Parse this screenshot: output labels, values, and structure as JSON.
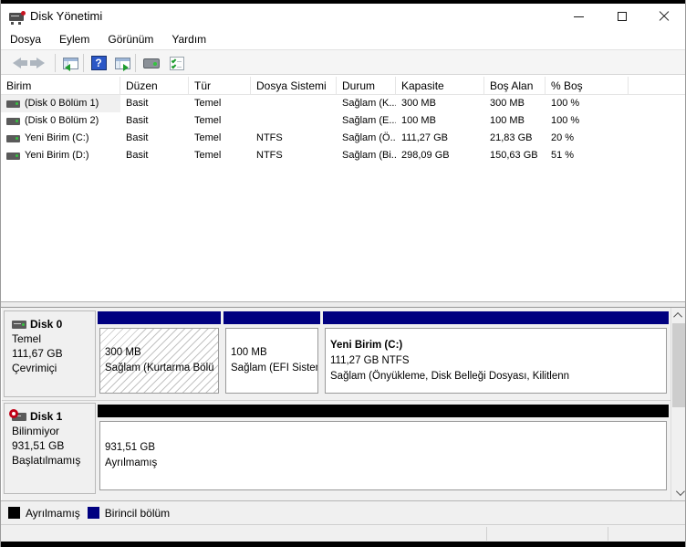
{
  "window": {
    "title": "Disk Yönetimi",
    "controls": {
      "icons": [
        "minimize-icon",
        "maximize-icon",
        "close-icon"
      ]
    }
  },
  "menu": {
    "items": [
      "Dosya",
      "Eylem",
      "Görünüm",
      "Yardım"
    ]
  },
  "toolbar": {
    "icons": [
      "back-icon",
      "forward-icon",
      "console-tree-toggle-icon",
      "help-icon",
      "action-pane-toggle-icon",
      "drive-properties-icon",
      "checklist-icon"
    ],
    "help_glyph": "?"
  },
  "volume_table": {
    "columns": [
      "Birim",
      "Düzen",
      "Tür",
      "Dosya Sistemi",
      "Durum",
      "Kapasite",
      "Boş Alan",
      "% Boş"
    ],
    "rows": [
      {
        "cells": [
          "(Disk 0 Bölüm 1)",
          "Basit",
          "Temel",
          "",
          "Sağlam (K...",
          "300 MB",
          "300 MB",
          "100 %"
        ]
      },
      {
        "cells": [
          "(Disk 0 Bölüm 2)",
          "Basit",
          "Temel",
          "",
          "Sağlam (E...",
          "100 MB",
          "100 MB",
          "100 %"
        ]
      },
      {
        "cells": [
          "Yeni Birim (C:)",
          "Basit",
          "Temel",
          "NTFS",
          "Sağlam (Ö...",
          "111,27 GB",
          "21,83 GB",
          "20 %"
        ]
      },
      {
        "cells": [
          "Yeni Birim (D:)",
          "Basit",
          "Temel",
          "NTFS",
          "Sağlam (Bi...",
          "298,09 GB",
          "150,63 GB",
          "51 %"
        ]
      }
    ]
  },
  "disks": [
    {
      "name": "Disk 0",
      "type": "Temel",
      "size": "111,67 GB",
      "status": "Çevrimiçi",
      "partitions": [
        {
          "title": "",
          "size_fs": "300 MB",
          "status": "Sağlam (Kurtarma Bölü",
          "band_color": "#000080",
          "fill": "hatched"
        },
        {
          "title": "",
          "size_fs": "100 MB",
          "status": "Sağlam (EFI Sisten",
          "band_color": "#000080",
          "fill": "white"
        },
        {
          "title": "Yeni Birim  (C:)",
          "size_fs": "111,27 GB NTFS",
          "status": "Sağlam (Önyükleme, Disk Belleği Dosyası, Kilitlenn",
          "band_color": "#000080",
          "fill": "white"
        }
      ]
    },
    {
      "name": "Disk 1",
      "type": "Bilinmiyor",
      "size": "931,51 GB",
      "status": "Başlatılmamış",
      "partitions": [
        {
          "title": "",
          "size_fs": "931,51 GB",
          "status": "Ayrılmamış",
          "band_color": "#000000",
          "fill": "white"
        }
      ]
    }
  ],
  "legend": {
    "items": [
      {
        "label": "Ayrılmamış",
        "color": "#000000"
      },
      {
        "label": "Birincil bölüm",
        "color": "#000080"
      }
    ]
  },
  "colors": {
    "primary_partition": "#000080",
    "unallocated": "#000000",
    "pane_background": "#f0f0f0",
    "window_background": "#ffffff"
  }
}
